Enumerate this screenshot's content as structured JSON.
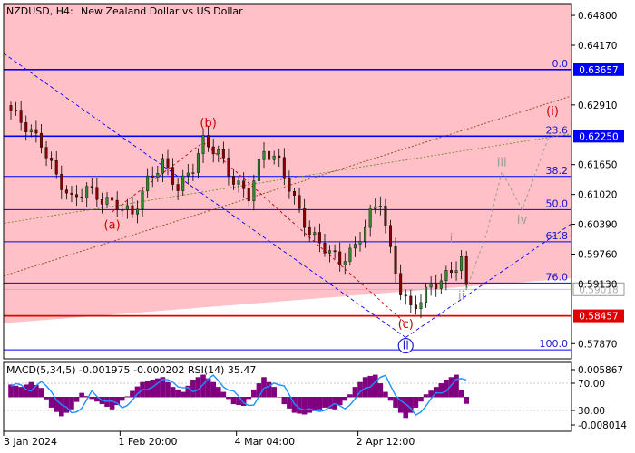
{
  "header": {
    "symbol": "NZDUSD, H4:",
    "description": "New Zealand Dollar vs US Dollar"
  },
  "colors": {
    "zone_pink": "#ffc0c8",
    "fib_blue": "#0000ff",
    "support_red": "#e00000",
    "bull_candle": "#2e8b2e",
    "bear_candle": "#8b0000",
    "wave_red": "#cc0000",
    "wave_gray": "#999999",
    "macd_hist": "#800080",
    "macd_signal": "#1e90ff"
  },
  "chart_data": [
    {
      "type": "candlestick",
      "title": "NZDUSD, H4:  New Zealand Dollar vs US Dollar",
      "ylim": [
        0.5755,
        0.6505
      ],
      "y_ticks": [
        "0.64800",
        "0.64170",
        "0.62910",
        "0.61650",
        "0.61020",
        "0.60390",
        "0.59760",
        "0.59130",
        "0.57870"
      ],
      "x_ticks": [
        "3 Jan 2024",
        "1 Feb 20:00",
        "4 Mar 04:00",
        "2 Apr 12:00"
      ],
      "x_tick_index": [
        0,
        23,
        46,
        70
      ],
      "bar_count": 91,
      "close_path": [
        [
          0,
          0.628
        ],
        [
          3,
          0.6245
        ],
        [
          6,
          0.621
        ],
        [
          9,
          0.614
        ],
        [
          12,
          0.609
        ],
        [
          15,
          0.6115
        ],
        [
          18,
          0.609
        ],
        [
          21,
          0.608
        ],
        [
          24,
          0.606
        ],
        [
          27,
          0.613
        ],
        [
          30,
          0.617
        ],
        [
          33,
          0.6115
        ],
        [
          36,
          0.616
        ],
        [
          38,
          0.6215
        ],
        [
          41,
          0.619
        ],
        [
          44,
          0.613
        ],
        [
          47,
          0.61
        ],
        [
          50,
          0.6195
        ],
        [
          53,
          0.617
        ],
        [
          56,
          0.609
        ],
        [
          59,
          0.602
        ],
        [
          62,
          0.599
        ],
        [
          65,
          0.596
        ],
        [
          68,
          0.599
        ],
        [
          71,
          0.606
        ],
        [
          73,
          0.609
        ],
        [
          75,
          0.598
        ],
        [
          77,
          0.59
        ],
        [
          79,
          0.586
        ],
        [
          81,
          0.588
        ],
        [
          83,
          0.591
        ],
        [
          85,
          0.592
        ],
        [
          87,
          0.594
        ],
        [
          89,
          0.5965
        ],
        [
          90,
          0.5902
        ]
      ],
      "current_price": "0.59018",
      "horizontal_levels": [
        {
          "label": "0.0",
          "value": 0.63657,
          "price_label": "0.63657",
          "highlight": true
        },
        {
          "label": "23.6",
          "value": 0.6225,
          "price_label": "0.62250",
          "highlight": true
        },
        {
          "label": "38.2",
          "value": 0.614,
          "price_label": "",
          "highlight": false
        },
        {
          "label": "50.0",
          "value": 0.607,
          "price_label": "",
          "highlight": false
        },
        {
          "label": "61.8",
          "value": 0.6002,
          "price_label": "",
          "highlight": false
        },
        {
          "label": "76.0",
          "value": 0.5915,
          "price_label": "",
          "highlight": false
        },
        {
          "label": "100.0",
          "value": 0.5774,
          "price_label": "",
          "highlight": false
        }
      ],
      "support_level": {
        "value": 0.58457,
        "price_label": "0.58457"
      },
      "wave_labels": [
        {
          "text": "(a)",
          "bar": 20,
          "price": 0.603,
          "color": "red"
        },
        {
          "text": "(b)",
          "bar": 39,
          "price": 0.6245,
          "color": "red"
        },
        {
          "text": "(c)",
          "bar": 78,
          "price": 0.582,
          "color": "red"
        },
        {
          "text": "ii",
          "bar": 78,
          "price": 0.5775,
          "color": "blue"
        },
        {
          "text": "i",
          "bar": 87,
          "price": 0.6002,
          "color": "gray"
        },
        {
          "text": "ii",
          "bar": 89,
          "price": 0.588,
          "color": "gray"
        },
        {
          "text": "iii",
          "bar": 97,
          "price": 0.6162,
          "color": "gray"
        },
        {
          "text": "iv",
          "bar": 101,
          "price": 0.604,
          "color": "gray"
        },
        {
          "text": "(i)",
          "bar": 107,
          "price": 0.627,
          "color": "red"
        }
      ]
    },
    {
      "type": "area",
      "title": "MACD(5,34,5) -0.001975 -0.000202 RSI(14) 35.47",
      "ylim": [
        -0.01,
        0.007
      ],
      "y_ticks": [
        "0.005867",
        "70.00",
        "30.00",
        "-0.008014"
      ],
      "macd_path": [
        [
          0,
          0.0025
        ],
        [
          2,
          0.002
        ],
        [
          4,
          0.003
        ],
        [
          6,
          0.0018
        ],
        [
          8,
          -0.003
        ],
        [
          10,
          -0.0055
        ],
        [
          12,
          -0.0035
        ],
        [
          14,
          0.0008
        ],
        [
          16,
          -0.0005
        ],
        [
          18,
          -0.002
        ],
        [
          20,
          -0.0035
        ],
        [
          22,
          -0.001
        ],
        [
          24,
          0.0012
        ],
        [
          26,
          0.003
        ],
        [
          28,
          0.0035
        ],
        [
          30,
          0.004
        ],
        [
          32,
          0.002
        ],
        [
          34,
          0.001
        ],
        [
          36,
          0.0035
        ],
        [
          38,
          0.0045
        ],
        [
          40,
          0.003
        ],
        [
          42,
          0.001
        ],
        [
          44,
          -0.002
        ],
        [
          46,
          -0.0025
        ],
        [
          48,
          0.0015
        ],
        [
          50,
          0.004
        ],
        [
          52,
          0.002
        ],
        [
          54,
          -0.002
        ],
        [
          56,
          -0.0045
        ],
        [
          58,
          -0.005
        ],
        [
          60,
          -0.004
        ],
        [
          62,
          -0.003
        ],
        [
          64,
          -0.0035
        ],
        [
          66,
          -0.001
        ],
        [
          68,
          0.002
        ],
        [
          70,
          0.004
        ],
        [
          72,
          0.0045
        ],
        [
          74,
          0.001
        ],
        [
          76,
          -0.003
        ],
        [
          78,
          -0.006
        ],
        [
          80,
          -0.003
        ],
        [
          82,
          0.0005
        ],
        [
          84,
          0.002
        ],
        [
          86,
          0.0035
        ],
        [
          88,
          0.0045
        ],
        [
          90,
          -0.0019
        ]
      ]
    }
  ]
}
